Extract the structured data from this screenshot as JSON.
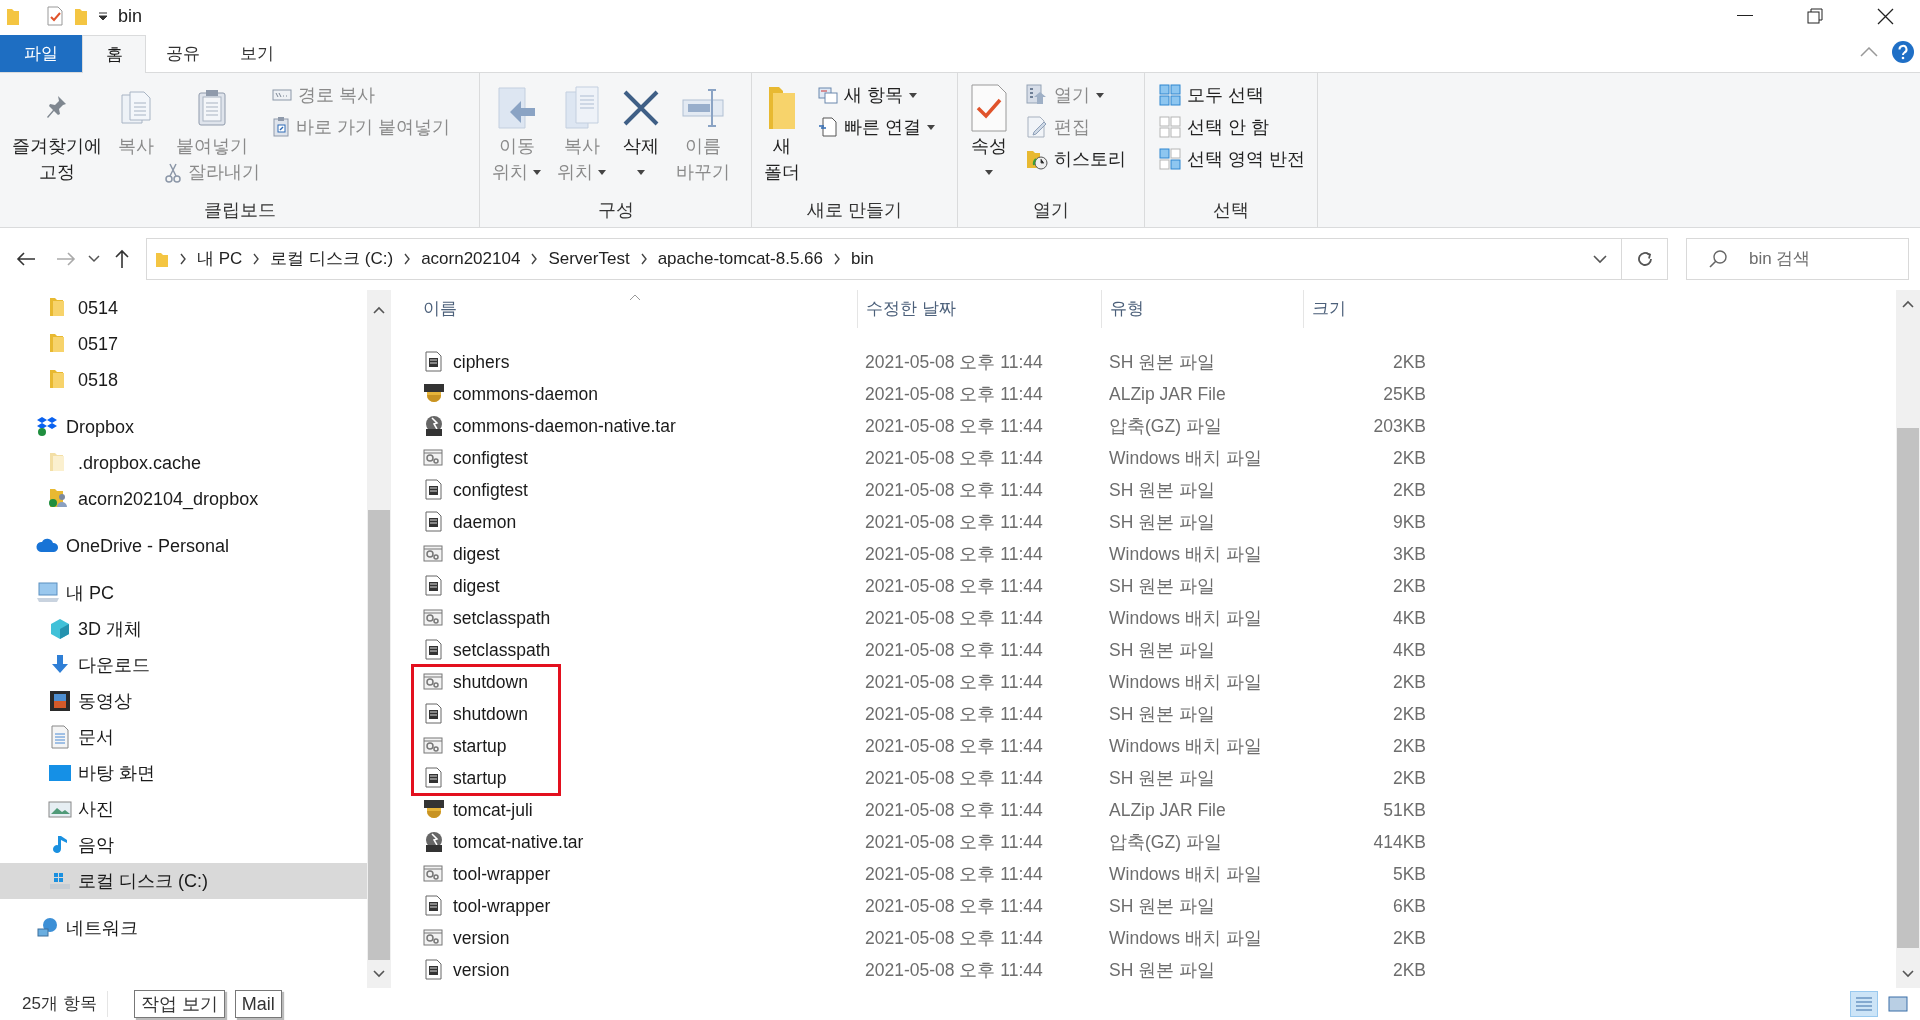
{
  "window": {
    "title": "bin"
  },
  "tabs": [
    {
      "label": "파일",
      "kind": "file",
      "selected": false
    },
    {
      "label": "홈",
      "kind": "tab",
      "selected": true
    },
    {
      "label": "공유",
      "kind": "tab",
      "selected": false
    },
    {
      "label": "보기",
      "kind": "tab",
      "selected": false
    }
  ],
  "ribbon": {
    "groups": [
      {
        "label": "클립보드",
        "columns": [
          {
            "kind": "large",
            "lines": [
              "즐겨찾기에",
              "고정"
            ],
            "disabled": false,
            "dropdown": false
          },
          {
            "kind": "large",
            "lines": [
              "복사"
            ],
            "disabled": true,
            "dropdown": false
          },
          {
            "kind": "large",
            "lines": [
              "붙여넣기"
            ],
            "disabled": true,
            "dropdown": false,
            "below": {
              "label": "잘라내기",
              "disabled": true
            }
          },
          {
            "kind": "stack",
            "items": [
              {
                "label": "경로 복사",
                "disabled": true,
                "dropdown": false
              },
              {
                "label": "바로 가기 붙여넣기",
                "disabled": true,
                "dropdown": false
              }
            ]
          }
        ]
      },
      {
        "label": "구성",
        "columns": [
          {
            "kind": "large",
            "lines": [
              "이동",
              "위치"
            ],
            "disabled": true,
            "dropdown": true
          },
          {
            "kind": "large",
            "lines": [
              "복사",
              "위치"
            ],
            "disabled": true,
            "dropdown": true
          },
          {
            "kind": "large",
            "lines": [
              "삭제"
            ],
            "disabled": false,
            "dropdown": true
          },
          {
            "kind": "large",
            "lines": [
              "이름",
              "바꾸기"
            ],
            "disabled": true,
            "dropdown": false
          }
        ]
      },
      {
        "label": "새로 만들기",
        "columns": [
          {
            "kind": "large",
            "lines": [
              "새",
              "폴더"
            ],
            "disabled": false,
            "dropdown": false
          },
          {
            "kind": "stack",
            "items": [
              {
                "label": "새 항목",
                "disabled": false,
                "dropdown": true
              },
              {
                "label": "빠른 연결",
                "disabled": false,
                "dropdown": true
              }
            ]
          }
        ]
      },
      {
        "label": "열기",
        "columns": [
          {
            "kind": "large",
            "lines": [
              "속성"
            ],
            "disabled": false,
            "dropdown": true
          },
          {
            "kind": "stack",
            "items": [
              {
                "label": "열기",
                "disabled": true,
                "dropdown": true
              },
              {
                "label": "편집",
                "disabled": true,
                "dropdown": false
              },
              {
                "label": "히스토리",
                "disabled": false,
                "dropdown": false
              }
            ]
          }
        ]
      },
      {
        "label": "선택",
        "columns": [
          {
            "kind": "stack",
            "items": [
              {
                "label": "모두 선택",
                "disabled": false,
                "dropdown": false
              },
              {
                "label": "선택 안 함",
                "disabled": false,
                "dropdown": false
              },
              {
                "label": "선택 영역 반전",
                "disabled": false,
                "dropdown": false
              }
            ]
          }
        ]
      }
    ]
  },
  "address": {
    "crumbs": [
      "내 PC",
      "로컬 디스크 (C:)",
      "acorn202104",
      "ServerTest",
      "apache-tomcat-8.5.66",
      "bin"
    ]
  },
  "search": {
    "placeholder": "bin 검색"
  },
  "sidebar": {
    "scrolled_children": [
      {
        "label": "0514",
        "kind": "folder",
        "selected": false
      },
      {
        "label": "0517",
        "kind": "folder",
        "selected": false
      },
      {
        "label": "0518",
        "kind": "folder",
        "selected": false
      }
    ],
    "tree": [
      {
        "label": "Dropbox",
        "kind": "dropbox",
        "selected": false,
        "children": [
          {
            "label": ".dropbox.cache",
            "kind": "pale-folder",
            "selected": false
          },
          {
            "label": "acorn202104_dropbox",
            "kind": "shared-folder",
            "selected": false
          }
        ]
      },
      {
        "label": "OneDrive - Personal",
        "kind": "cloud",
        "selected": false
      },
      {
        "label": "내 PC",
        "kind": "pc",
        "selected": false,
        "children": [
          {
            "label": "3D 개체",
            "kind": "cube",
            "selected": false
          },
          {
            "label": "다운로드",
            "kind": "download",
            "selected": false
          },
          {
            "label": "동영상",
            "kind": "video",
            "selected": false
          },
          {
            "label": "문서",
            "kind": "document",
            "selected": false
          },
          {
            "label": "바탕 화면",
            "kind": "desktop",
            "selected": false
          },
          {
            "label": "사진",
            "kind": "photo",
            "selected": false
          },
          {
            "label": "음악",
            "kind": "music",
            "selected": false
          },
          {
            "label": "로컬 디스크 (C:)",
            "kind": "drive",
            "selected": true
          }
        ]
      },
      {
        "label": "네트워크",
        "kind": "network",
        "selected": false
      }
    ]
  },
  "table": {
    "columns": [
      "이름",
      "수정한 날짜",
      "유형",
      "크기"
    ],
    "rows": [
      {
        "name": "ciphers",
        "date": "2021-05-08 오후 11:44",
        "type": "SH 원본 파일",
        "size": "2KB",
        "kind": "sh",
        "highlighted": false
      },
      {
        "name": "commons-daemon",
        "date": "2021-05-08 오후 11:44",
        "type": "ALZip JAR File",
        "size": "25KB",
        "kind": "jar",
        "highlighted": false
      },
      {
        "name": "commons-daemon-native.tar",
        "date": "2021-05-08 오후 11:44",
        "type": "압축(GZ) 파일",
        "size": "203KB",
        "kind": "gz",
        "highlighted": false
      },
      {
        "name": "configtest",
        "date": "2021-05-08 오후 11:44",
        "type": "Windows 배치 파일",
        "size": "2KB",
        "kind": "bat",
        "highlighted": false
      },
      {
        "name": "configtest",
        "date": "2021-05-08 오후 11:44",
        "type": "SH 원본 파일",
        "size": "2KB",
        "kind": "sh",
        "highlighted": false
      },
      {
        "name": "daemon",
        "date": "2021-05-08 오후 11:44",
        "type": "SH 원본 파일",
        "size": "9KB",
        "kind": "sh",
        "highlighted": false
      },
      {
        "name": "digest",
        "date": "2021-05-08 오후 11:44",
        "type": "Windows 배치 파일",
        "size": "3KB",
        "kind": "bat",
        "highlighted": false
      },
      {
        "name": "digest",
        "date": "2021-05-08 오후 11:44",
        "type": "SH 원본 파일",
        "size": "2KB",
        "kind": "sh",
        "highlighted": false
      },
      {
        "name": "setclasspath",
        "date": "2021-05-08 오후 11:44",
        "type": "Windows 배치 파일",
        "size": "4KB",
        "kind": "bat",
        "highlighted": false
      },
      {
        "name": "setclasspath",
        "date": "2021-05-08 오후 11:44",
        "type": "SH 원본 파일",
        "size": "4KB",
        "kind": "sh",
        "highlighted": false
      },
      {
        "name": "shutdown",
        "date": "2021-05-08 오후 11:44",
        "type": "Windows 배치 파일",
        "size": "2KB",
        "kind": "bat",
        "highlighted": true
      },
      {
        "name": "shutdown",
        "date": "2021-05-08 오후 11:44",
        "type": "SH 원본 파일",
        "size": "2KB",
        "kind": "sh",
        "highlighted": true
      },
      {
        "name": "startup",
        "date": "2021-05-08 오후 11:44",
        "type": "Windows 배치 파일",
        "size": "2KB",
        "kind": "bat",
        "highlighted": true
      },
      {
        "name": "startup",
        "date": "2021-05-08 오후 11:44",
        "type": "SH 원본 파일",
        "size": "2KB",
        "kind": "sh",
        "highlighted": true
      },
      {
        "name": "tomcat-juli",
        "date": "2021-05-08 오후 11:44",
        "type": "ALZip JAR File",
        "size": "51KB",
        "kind": "jar",
        "highlighted": false
      },
      {
        "name": "tomcat-native.tar",
        "date": "2021-05-08 오후 11:44",
        "type": "압축(GZ) 파일",
        "size": "414KB",
        "kind": "gz",
        "highlighted": false
      },
      {
        "name": "tool-wrapper",
        "date": "2021-05-08 오후 11:44",
        "type": "Windows 배치 파일",
        "size": "5KB",
        "kind": "bat",
        "highlighted": false
      },
      {
        "name": "tool-wrapper",
        "date": "2021-05-08 오후 11:44",
        "type": "SH 원본 파일",
        "size": "6KB",
        "kind": "sh",
        "highlighted": false
      },
      {
        "name": "version",
        "date": "2021-05-08 오후 11:44",
        "type": "Windows 배치 파일",
        "size": "2KB",
        "kind": "bat",
        "highlighted": false
      },
      {
        "name": "version",
        "date": "2021-05-08 오후 11:44",
        "type": "SH 원본 파일",
        "size": "2KB",
        "kind": "sh",
        "highlighted": false
      }
    ]
  },
  "status_bar": {
    "count": "25개 항목",
    "buttons": [
      "작업 보기",
      "Mail"
    ],
    "views": [
      {
        "kind": "details",
        "selected": true
      },
      {
        "kind": "large-icons",
        "selected": false
      }
    ]
  }
}
